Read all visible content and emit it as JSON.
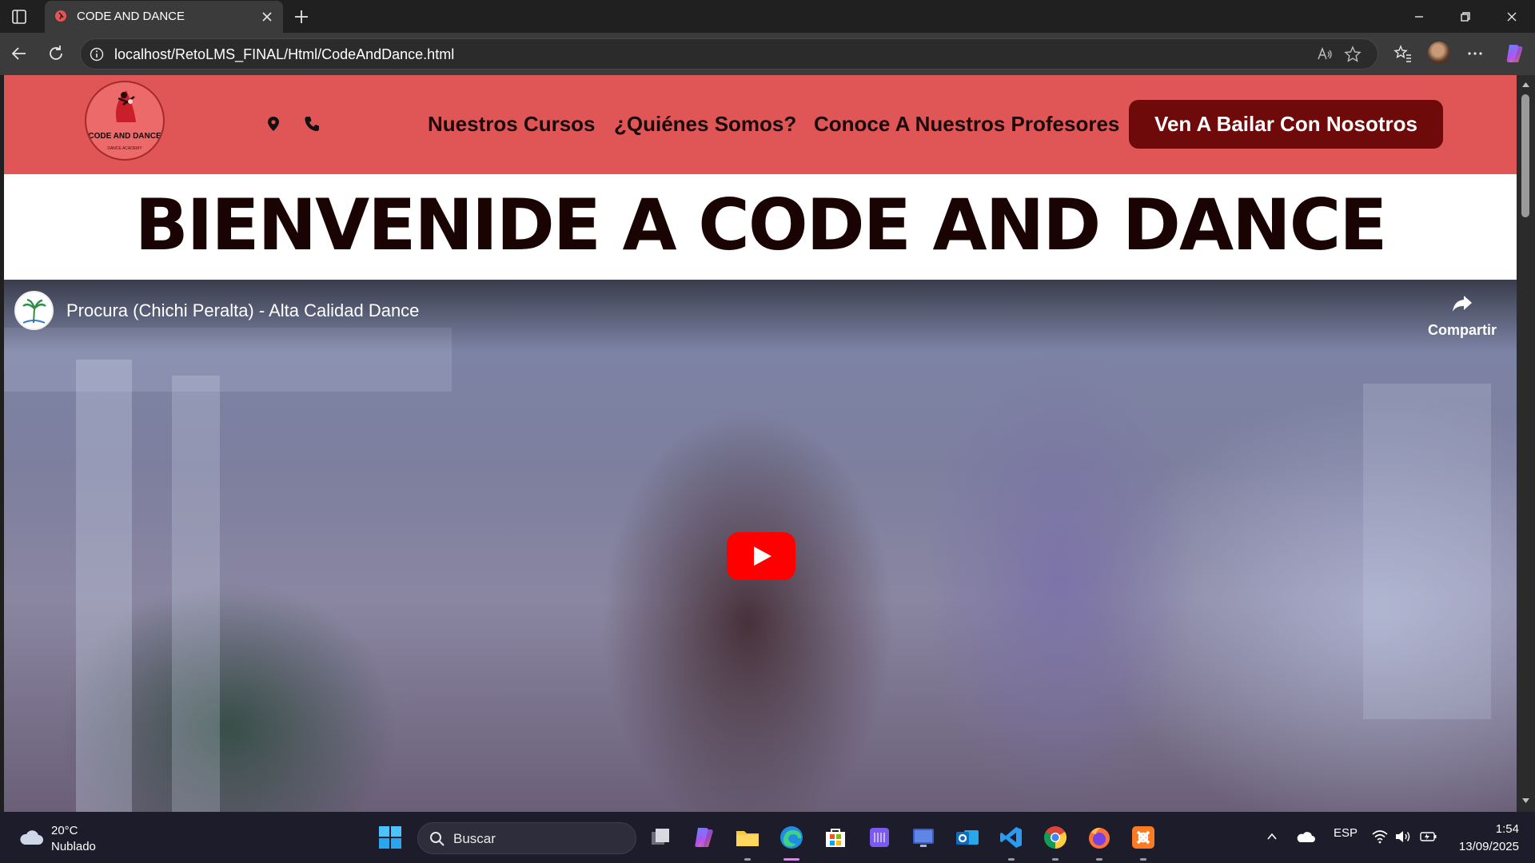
{
  "browser": {
    "tab_title": "CODE AND DANCE",
    "url": "localhost/RetoLMS_FINAL/Html/CodeAndDance.html"
  },
  "site": {
    "logo_text": "CODE AND DANCE",
    "logo_subtext": "DANCE ACADEMY",
    "nav": [
      {
        "label": "Nuestros Cursos"
      },
      {
        "label": "¿Quiénes Somos?"
      },
      {
        "label": "Conoce A Nuestros Profesores"
      }
    ],
    "cta_label": "Ven A Bailar Con Nosotros",
    "hero_title": "BIENVENIDE A CODE AND DANCE",
    "colors": {
      "header": "#e05555",
      "cta": "#6e0a0a",
      "title": "#1a0303"
    }
  },
  "video": {
    "title": "Procura (Chichi Peralta) - Alta Calidad Dance",
    "share_label": "Compartir"
  },
  "taskbar": {
    "weather_temp": "20°C",
    "weather_desc": "Nublado",
    "search_placeholder": "Buscar",
    "language": "ESP",
    "time": "1:54",
    "date": "13/09/2025"
  }
}
